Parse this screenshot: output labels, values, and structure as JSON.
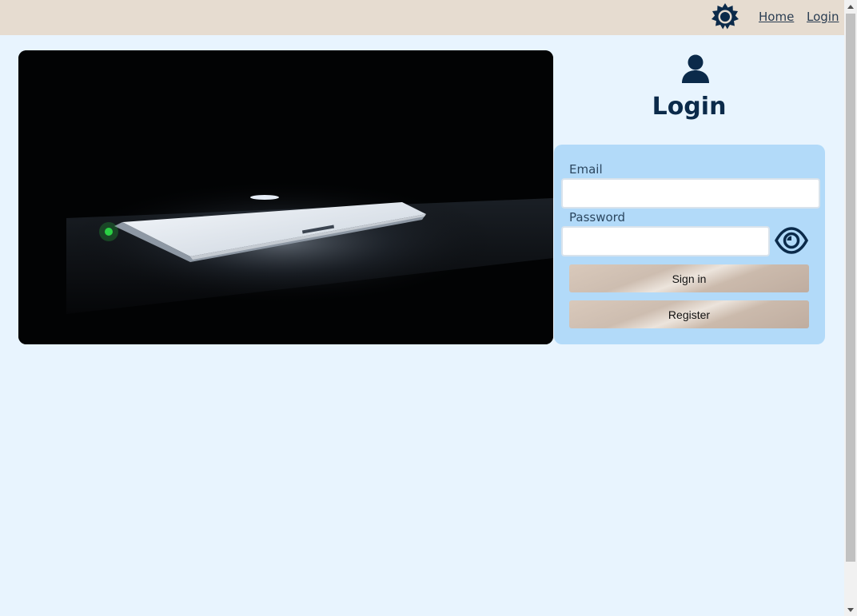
{
  "nav": {
    "theme_icon": "sun-gear-icon",
    "home_label": "Home",
    "login_label": "Login"
  },
  "hero": {
    "image": "laptop-in-dark-photo"
  },
  "login": {
    "icon": "user-icon",
    "title": "Login",
    "email_label": "Email",
    "email_value": "",
    "password_label": "Password",
    "password_value": "",
    "eye_icon": "eye-icon",
    "signin_label": "Sign in",
    "register_label": "Register"
  },
  "colors": {
    "page_bg": "#e8f4fe",
    "topbar_bg": "#e6dcd0",
    "card_bg": "#b2daf9",
    "accent": "#0b2a4a"
  }
}
